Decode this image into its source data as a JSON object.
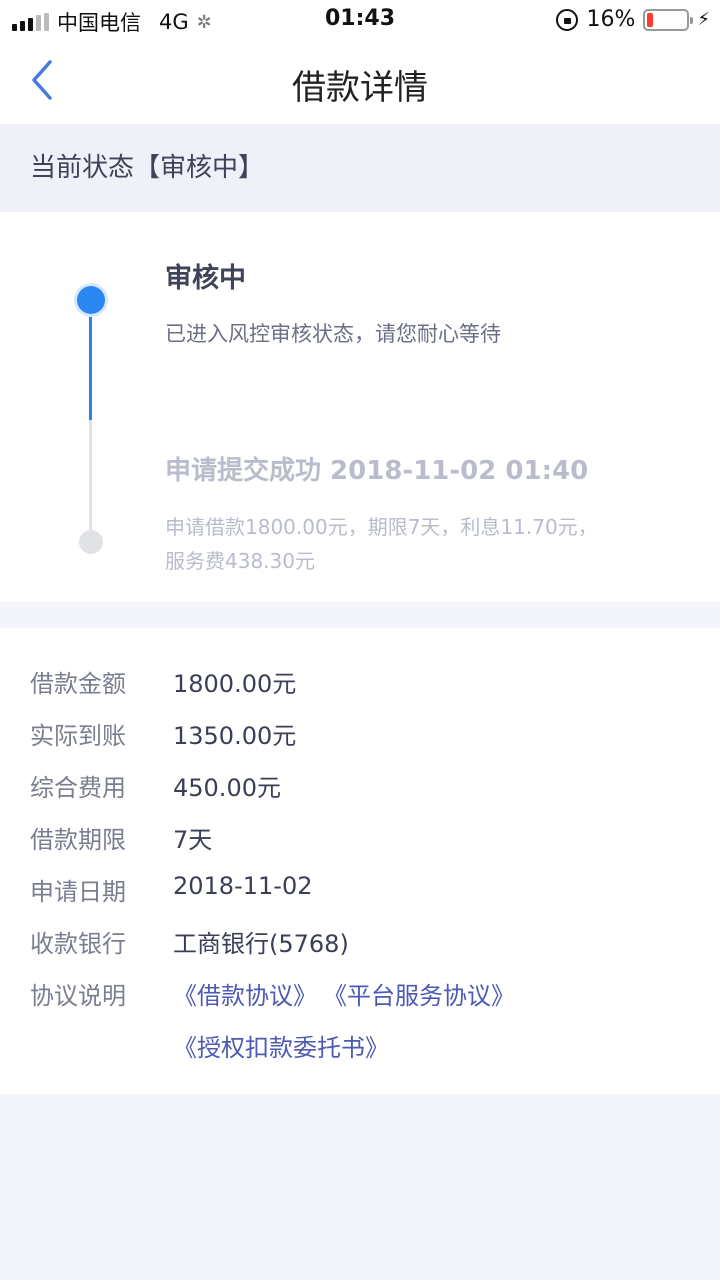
{
  "status_bar": {
    "carrier": "中国电信",
    "network": "4G",
    "time": "01:43",
    "battery": "16%",
    "battery_level": 0.16,
    "battery_color": "#ff3b30"
  },
  "nav": {
    "back_icon": "chevron-left-icon",
    "title": "借款详情"
  },
  "state": {
    "text": "当前状态【审核中】"
  },
  "timeline": [
    {
      "title": "审核中",
      "desc": "已进入风控审核状态，请您耐心等待",
      "active": true
    },
    {
      "title": "申请提交成功 2018-11-02 01:40",
      "desc": "申请借款1800.00元，期限7天，利息11.70元，服务费438.30元",
      "active": false
    }
  ],
  "details": {
    "rows": [
      {
        "label": "借款金额",
        "value": "1800.00元"
      },
      {
        "label": "实际到账",
        "value": "1350.00元"
      },
      {
        "label": "综合费用",
        "value": "450.00元"
      },
      {
        "label": "借款期限",
        "value": "7天"
      },
      {
        "label": "申请日期",
        "value": "2018-11-02"
      },
      {
        "label": "收款银行",
        "value": "工商银行(5768)"
      }
    ],
    "agreements_label": "协议说明",
    "agreements": [
      "《借款协议》",
      "《平台服务协议》",
      "《授权扣款委托书》"
    ]
  },
  "colors": {
    "accent": "#2a86f2",
    "link": "#4d5ab3",
    "background": "#f4f5fb"
  }
}
